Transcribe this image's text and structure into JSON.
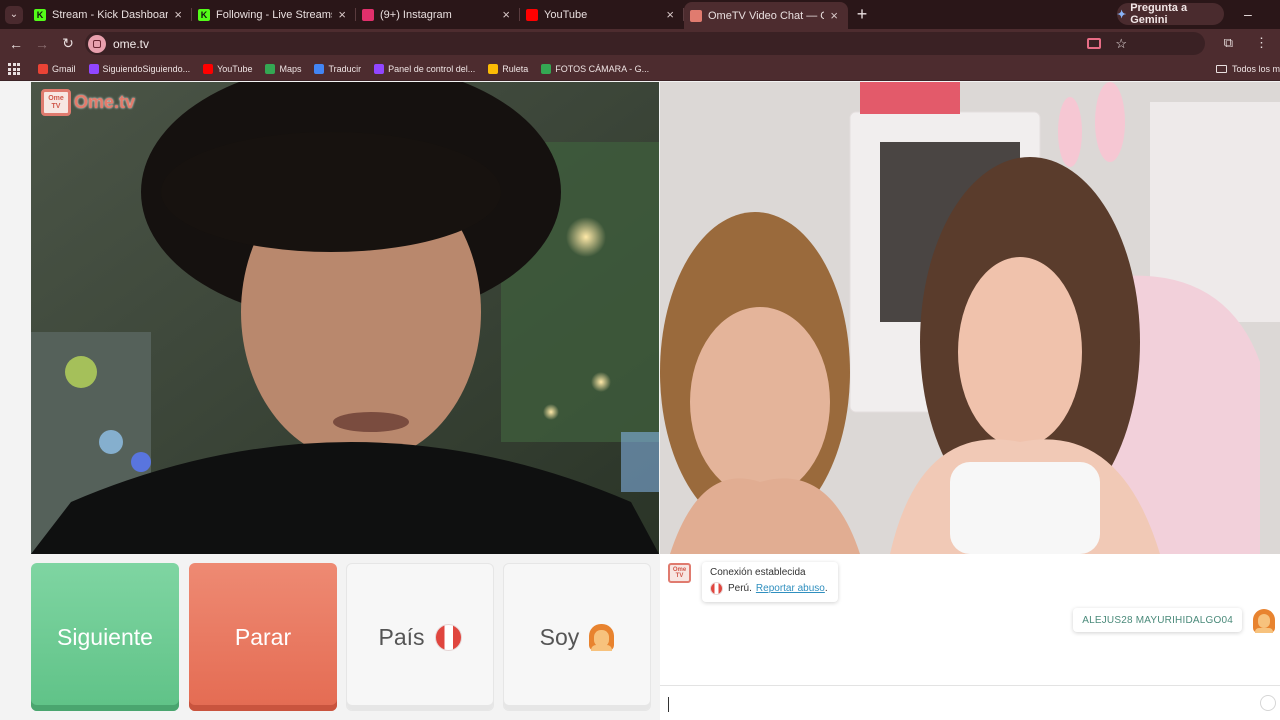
{
  "browser": {
    "tabs": [
      {
        "title": "Stream - Kick Dashboard",
        "favicon": "kick-icon",
        "color": "#53fc18",
        "letter": "K"
      },
      {
        "title": "Following - Live Streams on Kic",
        "favicon": "kick-icon",
        "color": "#53fc18",
        "letter": "K"
      },
      {
        "title": "(9+) Instagram",
        "favicon": "instagram-icon",
        "color": "#e1306c",
        "letter": ""
      },
      {
        "title": "YouTube",
        "favicon": "youtube-icon",
        "color": "#ff0000",
        "letter": ""
      },
      {
        "title": "OmeTV Video Chat — Ome",
        "favicon": "ometv-icon",
        "color": "#e07b6f",
        "letter": "",
        "active": true
      }
    ],
    "gemini_label": "Pregunta a Gemini",
    "url": "ome.tv",
    "bookmarks": [
      {
        "label": "Gmail",
        "color": "#ea4335"
      },
      {
        "label": "SiguiendoSiguiendo...",
        "color": "#9146ff"
      },
      {
        "label": "YouTube",
        "color": "#ff0000"
      },
      {
        "label": "Maps",
        "color": "#34a853"
      },
      {
        "label": "Traducir",
        "color": "#4285f4"
      },
      {
        "label": "Panel de control del...",
        "color": "#9146ff"
      },
      {
        "label": "Ruleta",
        "color": "#fbbc05"
      },
      {
        "label": "FOTOS CÁMARA - G...",
        "color": "#34a853"
      }
    ],
    "bookmarks_all": "Todos los m"
  },
  "ometv": {
    "logo_text": "Ome.tv",
    "logo_box": "Ome TV",
    "buttons": {
      "next": "Siguiente",
      "stop": "Parar",
      "country": "País",
      "gender": "Soy"
    },
    "chat": {
      "status": "Conexión establecida",
      "country": "Perú.",
      "report": "Reportar abuso",
      "report_suffix": ".",
      "username": "ALEJUS28 MAYURIHIDALGO04"
    }
  }
}
